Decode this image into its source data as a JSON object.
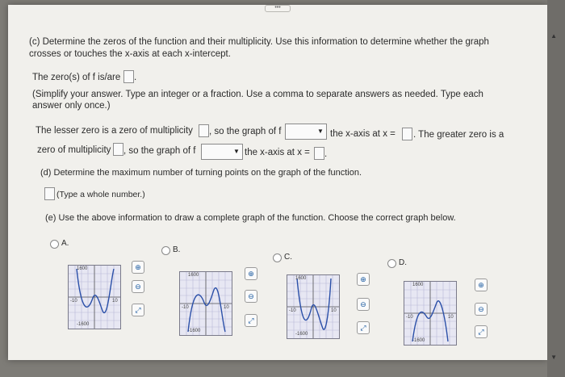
{
  "part_c": {
    "prompt_line1": "(c) Determine the zeros of the function and their multiplicity. Use this information to determine whether the graph",
    "prompt_line2": "crosses or touches the x-axis at each x-intercept.",
    "zeros_label": "The zero(s) of f is/are",
    "zeros_period": ".",
    "instruction_line1": "(Simplify your answer. Type an integer or a fraction. Use a comma to separate answers as needed. Type each",
    "instruction_line2": "answer only once.)",
    "lesser_label": "The lesser zero is a zero of multiplicity",
    "lesser_graph": ", so the graph of f",
    "lesser_axis": "the x-axis at x =",
    "greater_label": ". The greater zero is a",
    "greater_mult": "zero of multiplicity",
    "greater_graph": ", so the graph of f",
    "greater_axis": "the x-axis at x =",
    "end_period": "."
  },
  "part_d": {
    "prompt": "(d) Determine the maximum number of turning points on the graph of the function.",
    "answer_hint": "(Type a whole number.)"
  },
  "part_e": {
    "prompt": "(e) Use the above information to draw a complete graph of the function. Choose the correct graph below.",
    "options": [
      {
        "label": "A.",
        "ymax": "1600",
        "ymin": "-1600",
        "xmin": "-10",
        "xmax": "10"
      },
      {
        "label": "B.",
        "ymax": "1600",
        "ymin": "-1600",
        "xmin": "-10",
        "xmax": "10"
      },
      {
        "label": "C.",
        "ymax": "1600",
        "ymin": "-1600",
        "xmin": "-10",
        "xmax": "10"
      },
      {
        "label": "D.",
        "ymax": "1600",
        "ymin": "-1600",
        "xmin": "-10",
        "xmax": "10"
      }
    ],
    "axis_y": "y",
    "axis_x": "x"
  },
  "icons": {
    "zoom_in": "zoom-in-icon",
    "zoom_out": "zoom-out-icon",
    "expand": "expand-icon"
  },
  "colors": {
    "page": "#f1f0ec",
    "graph_bg": "#e7e7f3",
    "curve": "#2a4fa8"
  }
}
